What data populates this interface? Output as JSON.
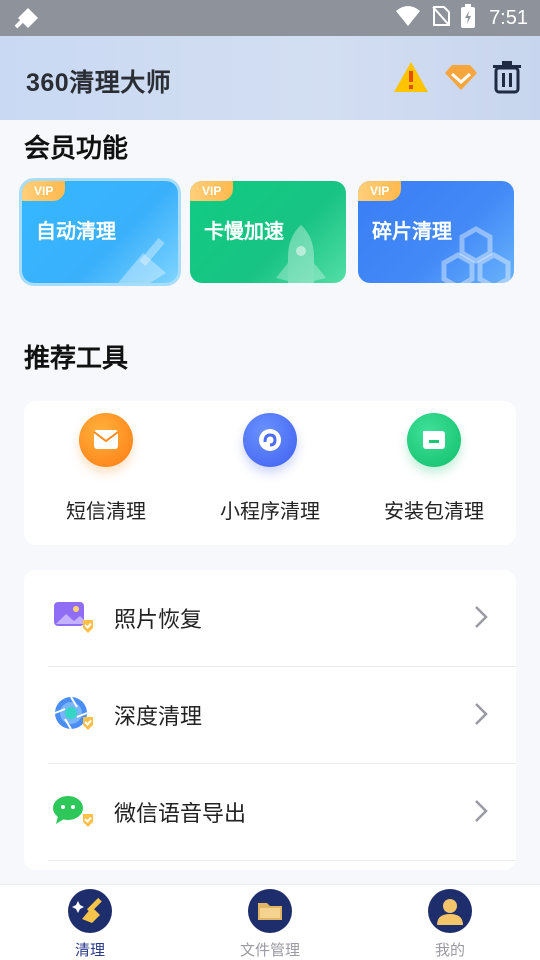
{
  "status_bar": {
    "time": "7:51",
    "icons": [
      "signal-icon",
      "wifi-icon",
      "no-sim-icon",
      "battery-icon"
    ]
  },
  "header": {
    "app_name": "360清理大师",
    "icons": [
      "warning-icon",
      "vip-diamond-icon",
      "trash-icon"
    ]
  },
  "vip_section": {
    "title": "会员功能",
    "cards": [
      {
        "badge": "VIP",
        "label": "自动清理",
        "icon": "broom-icon"
      },
      {
        "badge": "VIP",
        "label": "卡慢加速",
        "icon": "rocket-icon"
      },
      {
        "badge": "VIP",
        "label": "碎片清理",
        "icon": "hexagon-icon"
      }
    ]
  },
  "tools_section": {
    "title": "推荐工具",
    "tools": [
      {
        "label": "短信清理",
        "icon": "message-icon",
        "color": "#ff8a1c"
      },
      {
        "label": "小程序清理",
        "icon": "mini-program-icon",
        "color": "#4b6ef5"
      },
      {
        "label": "安装包清理",
        "icon": "package-icon",
        "color": "#16c774"
      }
    ]
  },
  "list": [
    {
      "label": "照片恢复",
      "icon": "photo-icon"
    },
    {
      "label": "深度清理",
      "icon": "camera-aperture-icon"
    },
    {
      "label": "微信语音导出",
      "icon": "wechat-icon"
    }
  ],
  "bottom_nav": [
    {
      "label": "清理",
      "icon": "clean-icon",
      "active": true
    },
    {
      "label": "文件管理",
      "icon": "folder-icon",
      "active": false
    },
    {
      "label": "我的",
      "icon": "profile-icon",
      "active": false
    }
  ]
}
